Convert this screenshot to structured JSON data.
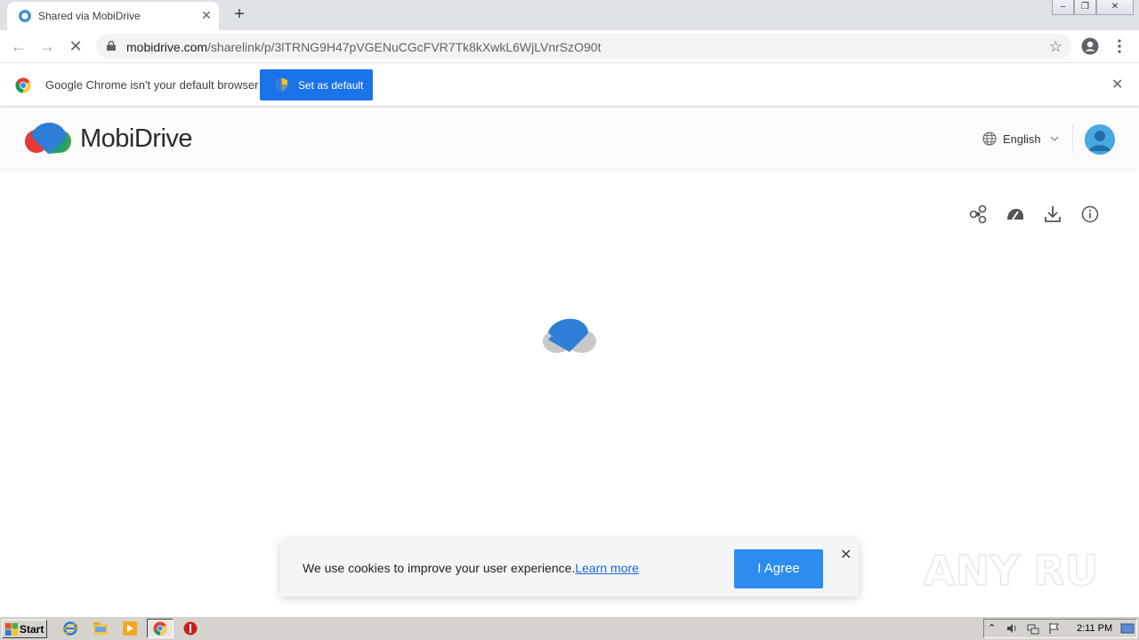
{
  "browser": {
    "tab_title": "Shared via MobiDrive",
    "url_host": "mobidrive.com",
    "url_path": "/sharelink/p/3lTRNG9H47pVGENuCGcFVR7Tk8kXwkL6WjLVnrSzO90t"
  },
  "infobar": {
    "message": "Google Chrome isn't your default browser",
    "button_label": "Set as default"
  },
  "header": {
    "brand_name": "MobiDrive",
    "language": "English"
  },
  "cookie": {
    "message": "We use cookies to improve your user experience.",
    "link_label": "Learn more",
    "agree_label": "I Agree"
  },
  "taskbar": {
    "start_label": "Start",
    "clock": "2:11 PM"
  },
  "watermark": "ANY RUN",
  "colors": {
    "brand_blue": "#1a73e8",
    "agree_blue": "#2d8cf0",
    "link_blue": "#1769d9"
  }
}
